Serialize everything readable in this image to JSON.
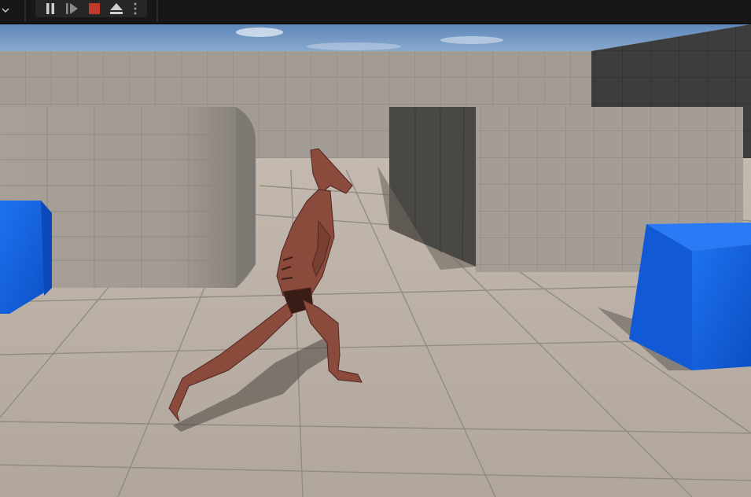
{
  "toolbar": {
    "collapse_icon": "chevron-down-icon",
    "buttons": [
      {
        "name": "pause-button",
        "icon": "pause-icon"
      },
      {
        "name": "step-frame-button",
        "icon": "step-forward-icon"
      },
      {
        "name": "stop-button",
        "icon": "stop-icon",
        "color": "#c0392b"
      },
      {
        "name": "eject-button",
        "icon": "eject-icon"
      },
      {
        "name": "more-options-button",
        "icon": "kebab-menu-icon"
      }
    ]
  },
  "viewport": {
    "scene": "third-person-template-level",
    "colors": {
      "sky": "#7fa6cf",
      "floor": "#b6aca2",
      "grid_wall": "#a39c94",
      "dark_wall": "#3e3e3e",
      "cube": "#1565e6"
    }
  }
}
